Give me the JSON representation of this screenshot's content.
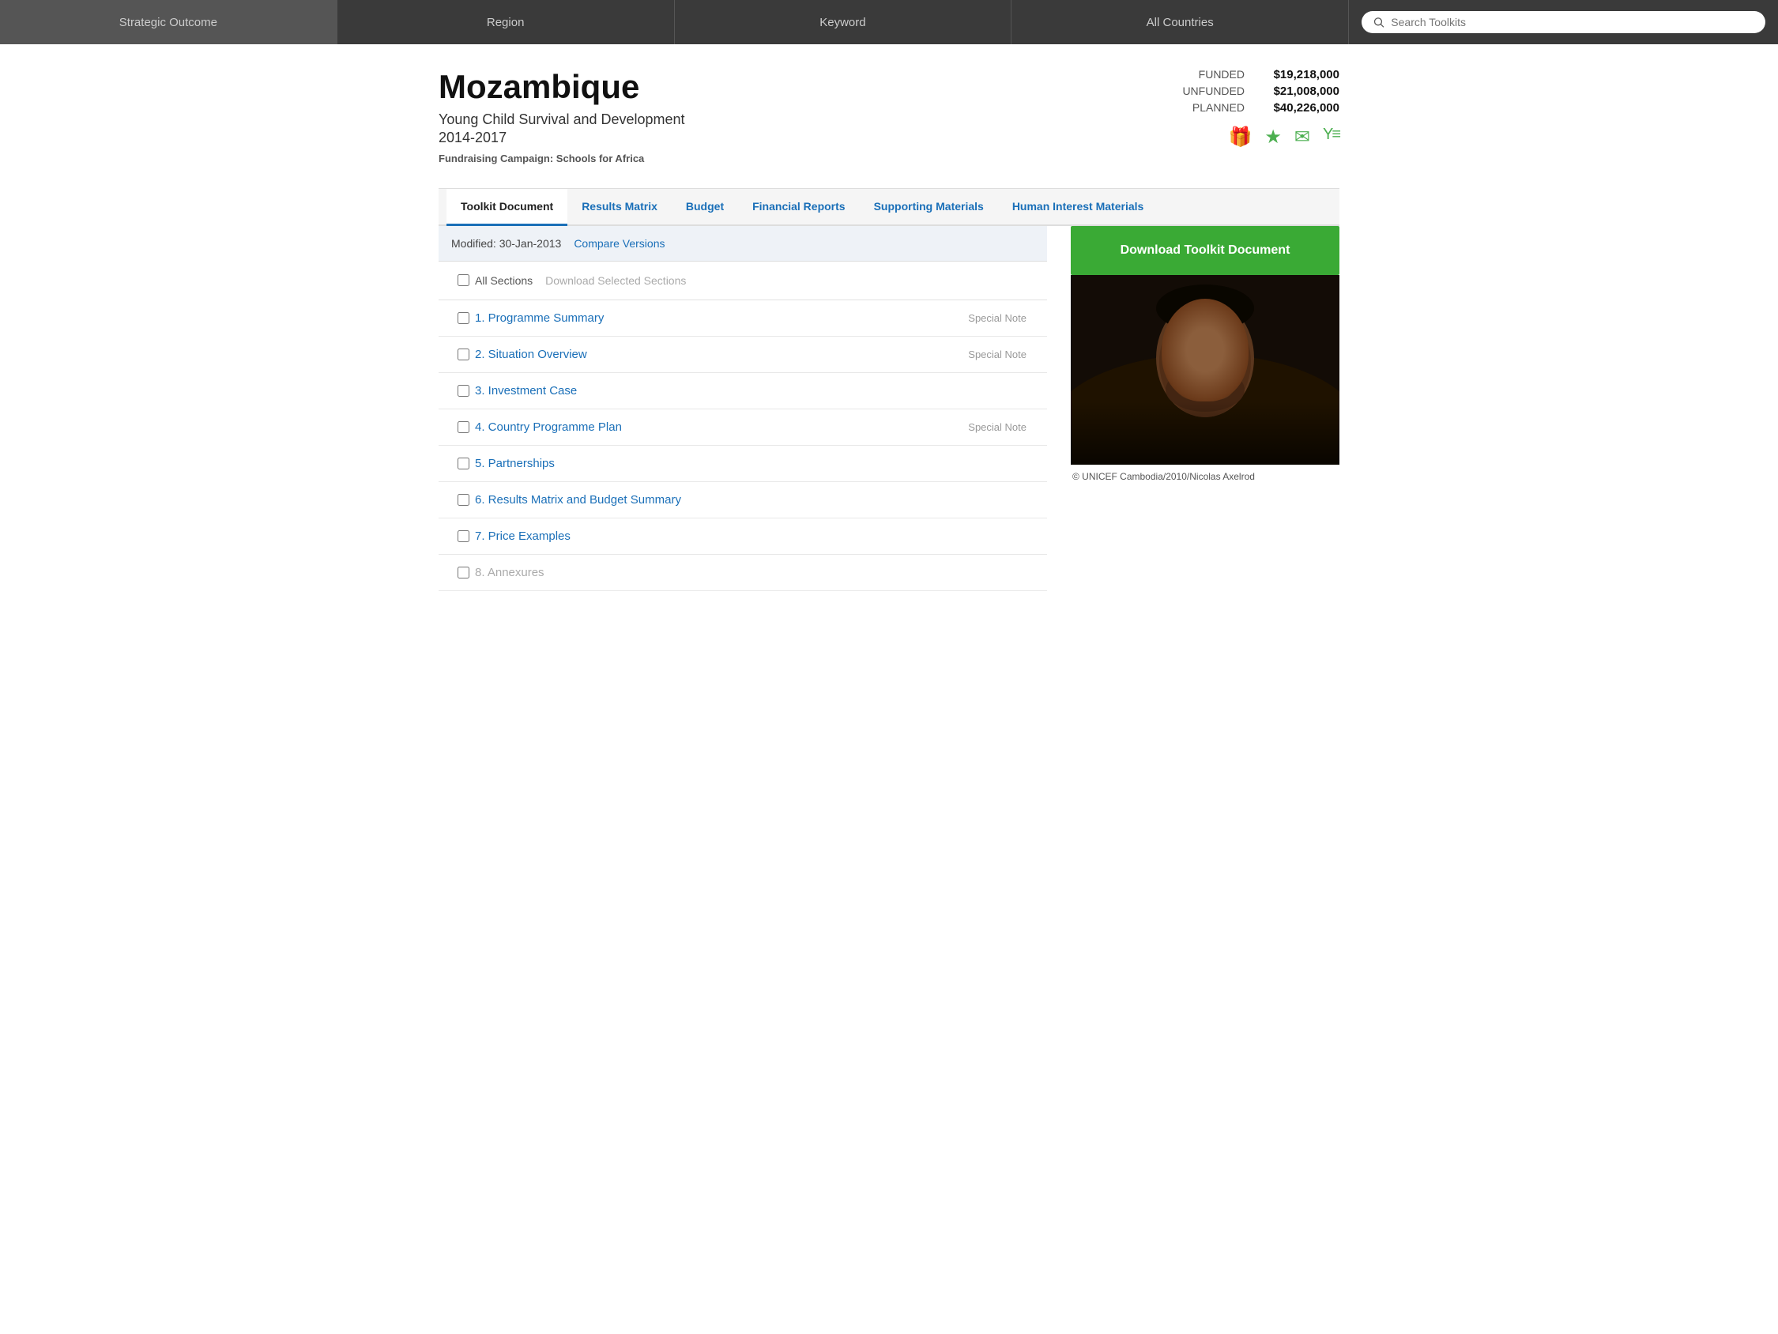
{
  "nav": {
    "items": [
      {
        "id": "strategic-outcome",
        "label": "Strategic Outcome"
      },
      {
        "id": "region",
        "label": "Region"
      },
      {
        "id": "keyword",
        "label": "Keyword"
      },
      {
        "id": "all-countries",
        "label": "All Countries"
      }
    ],
    "search": {
      "placeholder": "Search Toolkits"
    }
  },
  "page": {
    "title": "Mozambique",
    "subtitle": "Young Child Survival and Development\n2014-2017",
    "campaign_label": "Fundraising Campaign:",
    "campaign_value": "Schools for Africa"
  },
  "funding": {
    "rows": [
      {
        "label": "FUNDED",
        "value": "$19,218,000"
      },
      {
        "label": "UNFUNDED",
        "value": "$21,008,000"
      },
      {
        "label": "PLANNED",
        "value": "$40,226,000"
      }
    ]
  },
  "icons": {
    "gift": "🎁",
    "star": "★",
    "mail": "✉",
    "chart": "¥≡"
  },
  "tabs": [
    {
      "id": "toolkit-document",
      "label": "Toolkit Document",
      "active": true
    },
    {
      "id": "results-matrix",
      "label": "Results Matrix",
      "active": false
    },
    {
      "id": "budget",
      "label": "Budget",
      "active": false
    },
    {
      "id": "financial-reports",
      "label": "Financial Reports",
      "active": false
    },
    {
      "id": "supporting-materials",
      "label": "Supporting Materials",
      "active": false
    },
    {
      "id": "human-interest-materials",
      "label": "Human Interest Materials",
      "active": false
    }
  ],
  "modified": {
    "text": "Modified: 30-Jan-2013",
    "compare_label": "Compare Versions"
  },
  "sections_header": {
    "all_sections_label": "All Sections",
    "download_selected_label": "Download Selected Sections"
  },
  "sections": [
    {
      "id": "s1",
      "label": "1. Programme Summary",
      "special_note": "Special Note"
    },
    {
      "id": "s2",
      "label": "2. Situation Overview",
      "special_note": "Special Note"
    },
    {
      "id": "s3",
      "label": "3. Investment Case",
      "special_note": ""
    },
    {
      "id": "s4",
      "label": "4. Country Programme Plan",
      "special_note": "Special Note"
    },
    {
      "id": "s5",
      "label": "5. Partnerships",
      "special_note": ""
    },
    {
      "id": "s6",
      "label": "6. Results Matrix and Budget Summary",
      "special_note": ""
    },
    {
      "id": "s7",
      "label": "7. Price Examples",
      "special_note": ""
    },
    {
      "id": "s8",
      "label": "8. Annexures",
      "special_note": ""
    }
  ],
  "download_button": {
    "label": "Download Toolkit Document"
  },
  "photo": {
    "caption": "© UNICEF Cambodia/2010/Nicolas Axelrod"
  }
}
